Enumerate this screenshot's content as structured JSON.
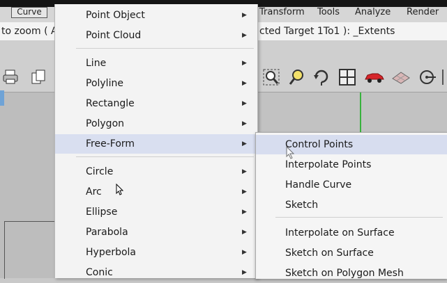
{
  "menubar": {
    "curve_label": "Curve",
    "transform_label": "Transform",
    "tools_label": "Tools",
    "analyze_label": "Analyze",
    "render_label": "Render"
  },
  "command": {
    "left_text": "to zoom ( A",
    "right_text": "cted  Target  1To1 ): _Extents"
  },
  "curve_menu": {
    "items": [
      {
        "label": "Point Object",
        "has_submenu": true
      },
      {
        "label": "Point Cloud",
        "has_submenu": true
      },
      {
        "label": "Line",
        "has_submenu": true
      },
      {
        "label": "Polyline",
        "has_submenu": true
      },
      {
        "label": "Rectangle",
        "has_submenu": true
      },
      {
        "label": "Polygon",
        "has_submenu": true
      },
      {
        "label": "Free-Form",
        "has_submenu": true,
        "highlighted": true
      },
      {
        "label": "Circle",
        "has_submenu": true
      },
      {
        "label": "Arc",
        "has_submenu": true
      },
      {
        "label": "Ellipse",
        "has_submenu": true
      },
      {
        "label": "Parabola",
        "has_submenu": true
      },
      {
        "label": "Hyperbola",
        "has_submenu": true
      },
      {
        "label": "Conic",
        "has_submenu": true
      }
    ]
  },
  "freeform_submenu": {
    "items": [
      {
        "label": "Control Points",
        "highlighted": true
      },
      {
        "label": "Interpolate Points"
      },
      {
        "label": "Handle Curve"
      },
      {
        "label": "Sketch"
      },
      {
        "label": "Interpolate on Surface"
      },
      {
        "label": "Sketch on Surface"
      },
      {
        "label": "Sketch on Polygon Mesh"
      }
    ]
  },
  "toolbar_icons": [
    "print-icon",
    "copy-icon",
    "zoom-window-icon",
    "zoom-extents-icon",
    "rotate-view-icon",
    "four-viewports-icon",
    "render-car-icon",
    "shaded-icon",
    "target-icon"
  ],
  "colors": {
    "highlight": "#d9dff0",
    "axis_green": "#39b23d"
  }
}
